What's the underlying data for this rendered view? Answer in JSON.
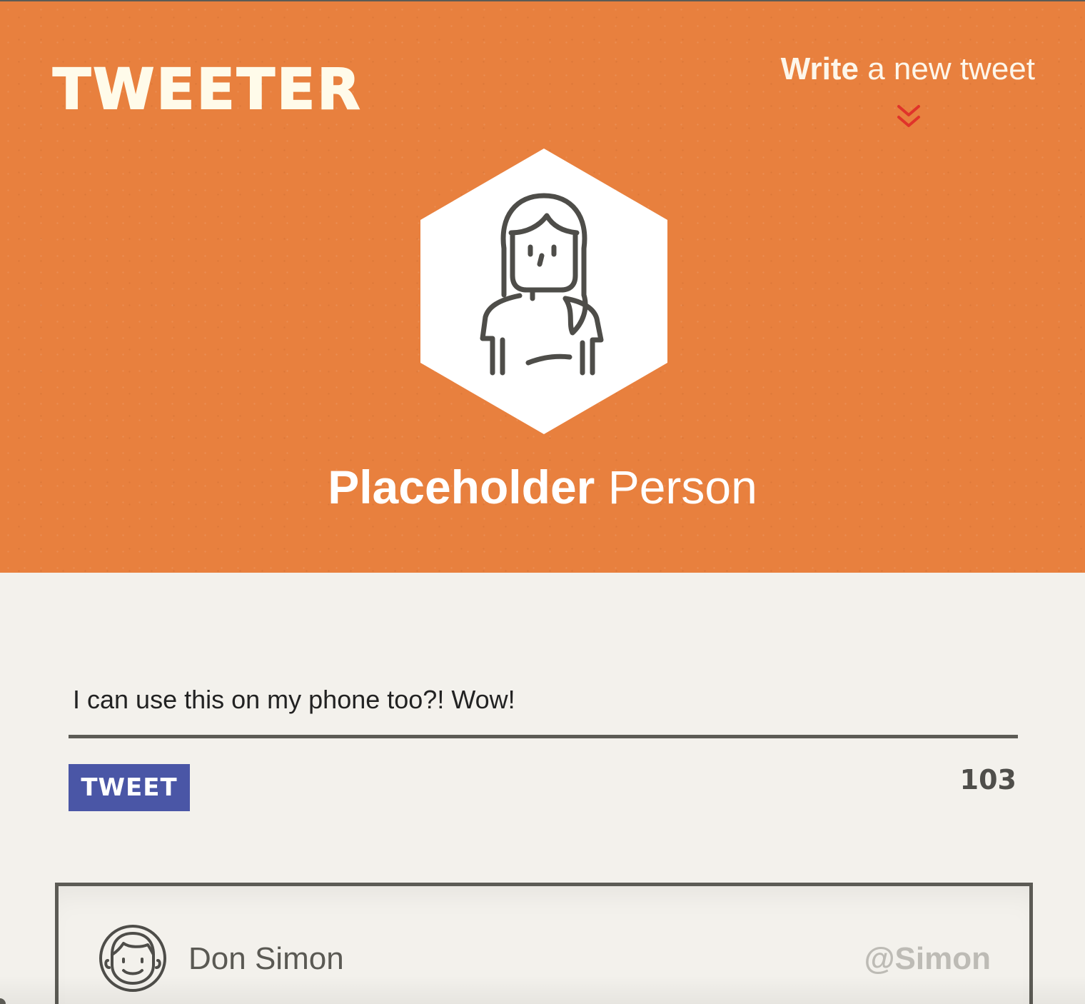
{
  "app": {
    "logo": "TWEETER"
  },
  "header": {
    "write_link": {
      "bold": "Write",
      "rest": "a new tweet"
    },
    "chevron_icon": "double-chevron-down-icon",
    "avatar_icon": "woman-avatar-icon",
    "profile": {
      "first_name": "Placeholder",
      "last_name": "Person"
    }
  },
  "compose": {
    "input_value": "I can use this on my phone too?! Wow!",
    "tweet_button_label": "TWEET",
    "char_count": "103"
  },
  "tweets": [
    {
      "avatar_icon": "man-avatar-icon",
      "name": "Don Simon",
      "handle": "@Simon"
    }
  ],
  "colors": {
    "header_bg": "#e8803e",
    "page_bg": "#f3f1ec",
    "button_bg": "#4a56a6",
    "chevron": "#e0332a",
    "border": "#5c5b55",
    "handle": "#bdbbb5"
  }
}
